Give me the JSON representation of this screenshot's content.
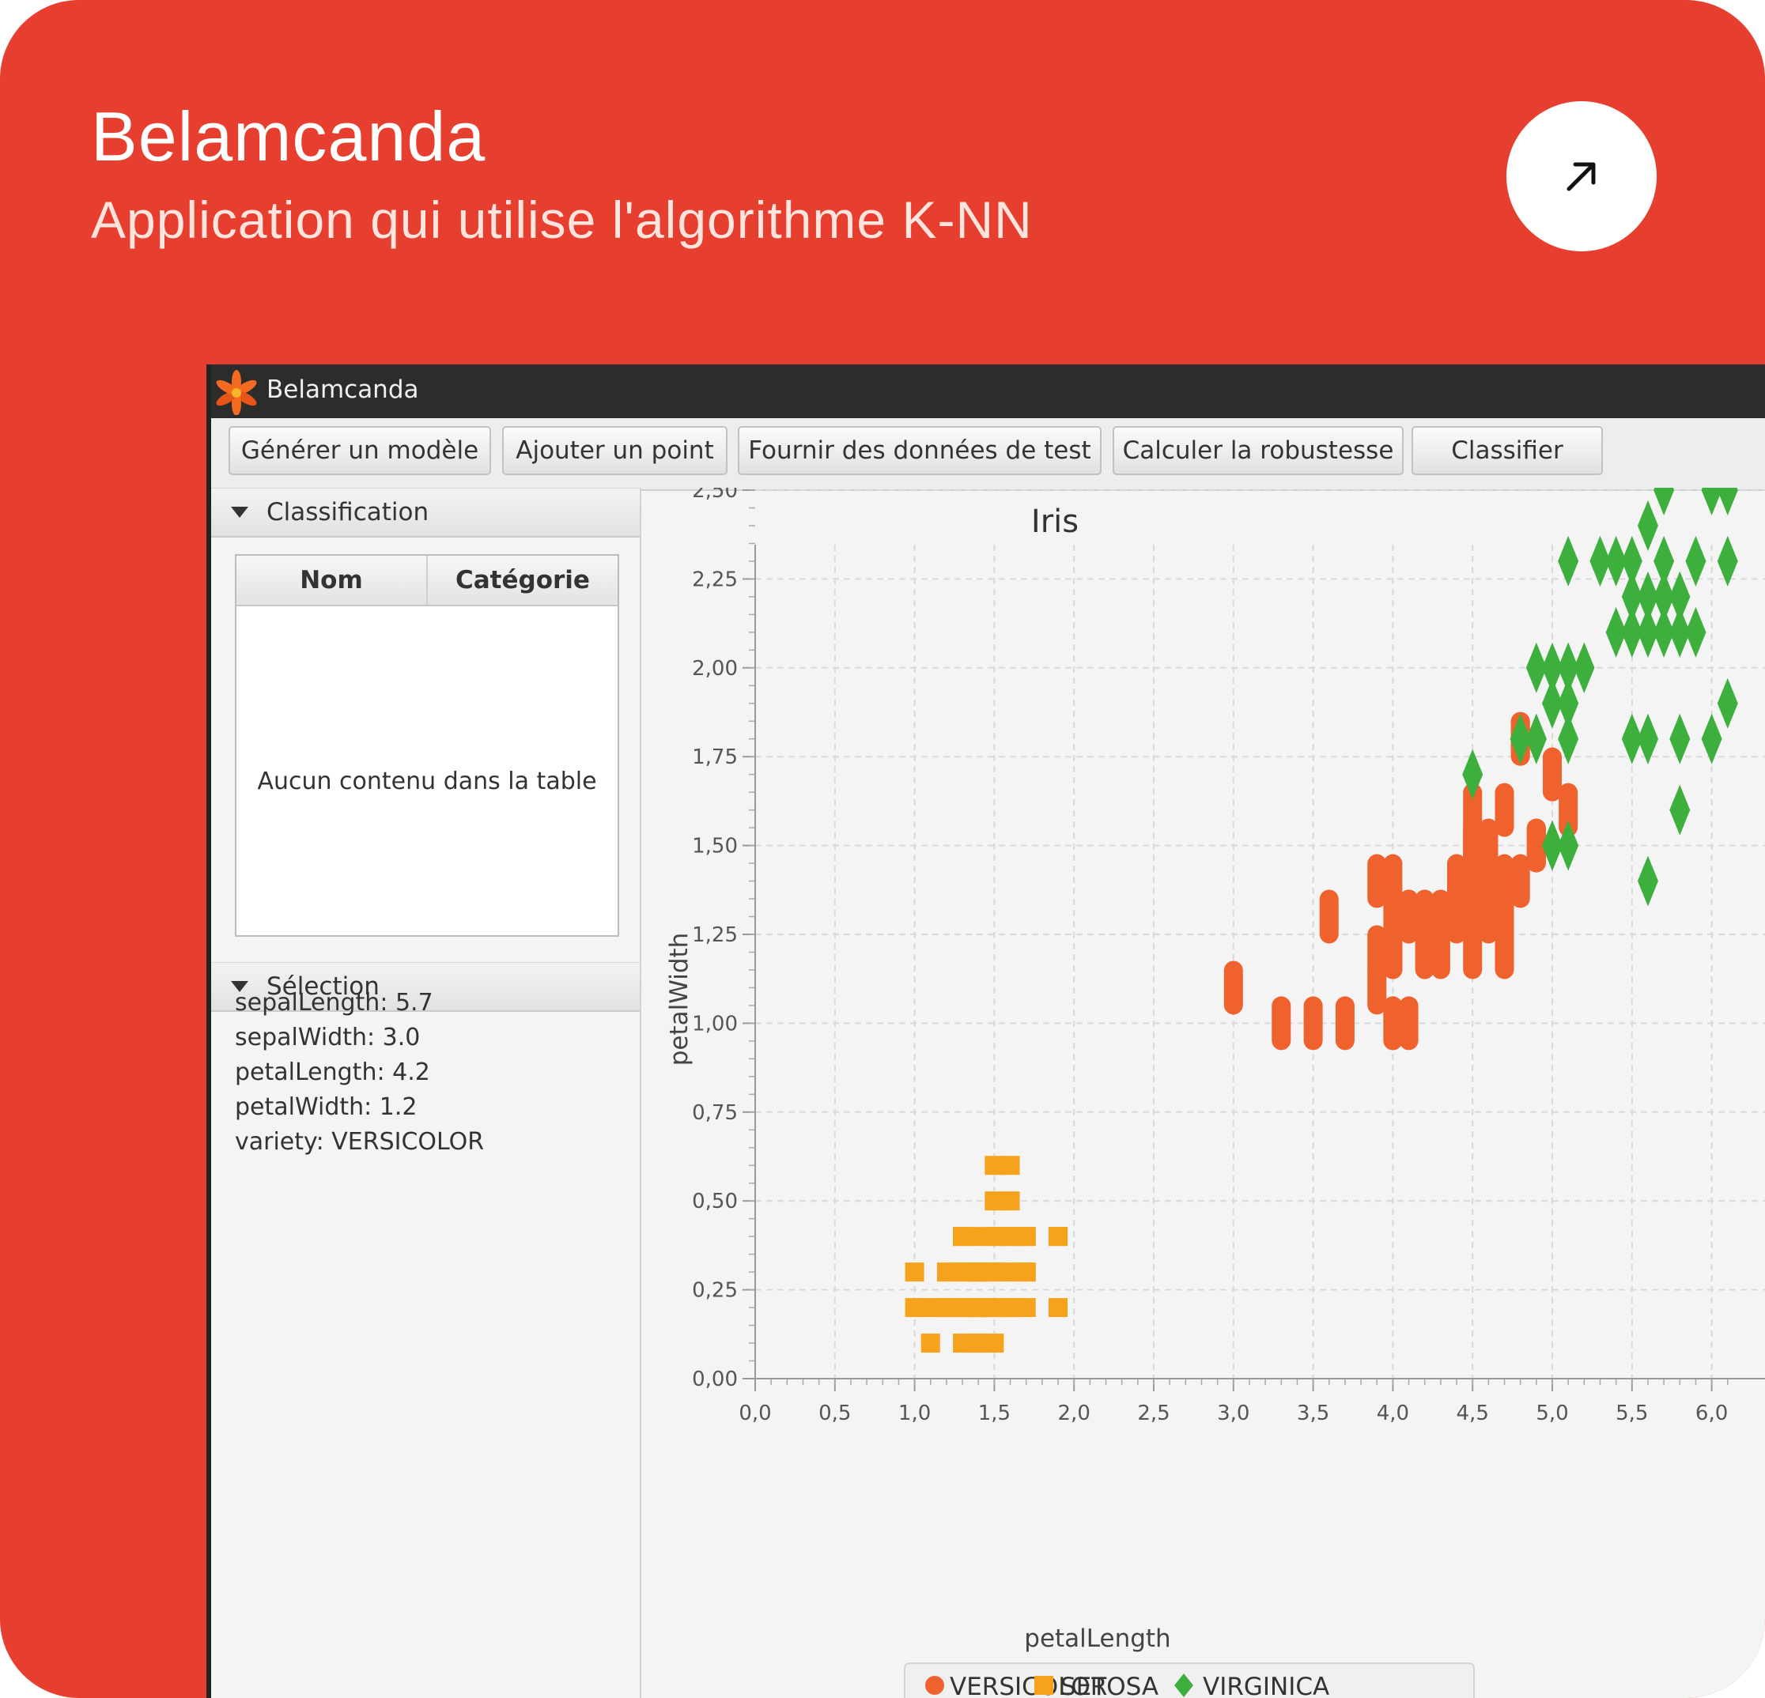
{
  "card": {
    "title": "Belamcanda",
    "subtitle": "Application qui utilise l'algorithme K-NN",
    "background_color": "#e63e2f"
  },
  "open_button": {
    "icon": "arrow-up-right-icon"
  },
  "window": {
    "title": "Belamcanda",
    "app_icon": "lily-flower-icon"
  },
  "toolbar": {
    "buttons": [
      {
        "label": "Générer un modèle"
      },
      {
        "label": "Ajouter un point"
      },
      {
        "label": "Fournir des données de test"
      },
      {
        "label": "Calculer la robustesse"
      },
      {
        "label": "Classifier"
      }
    ]
  },
  "classification_panel": {
    "title": "Classification",
    "columns": [
      "Nom",
      "Catégorie"
    ],
    "empty_message": "Aucun contenu dans la table"
  },
  "selection_panel": {
    "title": "Sélection",
    "properties": [
      "sepalLength: 5.7",
      "sepalWidth: 3.0",
      "petalLength: 4.2",
      "petalWidth: 1.2",
      "variety: VERSICOLOR"
    ]
  },
  "chart_data": {
    "type": "scatter",
    "title": "Iris",
    "xlabel": "petalLength",
    "ylabel": "petalWidth",
    "xlim": [
      0,
      6.1
    ],
    "ylim": [
      0,
      2.75
    ],
    "x_ticks": [
      "0,0",
      "0,5",
      "1,0",
      "1,5",
      "2,0",
      "2,5",
      "3,0",
      "3,5",
      "4,0",
      "4,5",
      "5,0",
      "5,5",
      "6,0"
    ],
    "y_ticks": [
      "0,00",
      "0,25",
      "0,50",
      "0,75",
      "1,00",
      "1,25",
      "1,50",
      "1,75",
      "2,00",
      "2,25",
      "2,50"
    ],
    "grid": true,
    "legend_position": "bottom",
    "series": [
      {
        "name": "VERSICOLOR",
        "marker": "circle",
        "color": "#f0622d",
        "x": [
          3.0,
          3.3,
          3.5,
          3.7,
          3.9,
          4.0,
          4.0,
          3.9,
          4.0,
          4.1,
          4.2,
          4.3,
          4.5,
          4.0,
          4.1,
          4.2,
          4.3,
          4.4,
          4.5,
          4.6,
          4.7,
          4.0,
          4.2,
          4.4,
          4.7,
          4.5,
          4.9,
          5.0,
          4.5,
          4.6,
          4.7,
          4.8,
          4.8,
          5.0,
          4.9,
          5.1,
          3.6,
          4.1,
          4.5,
          4.7,
          4.5,
          4.6,
          4.8,
          4.9,
          3.9,
          4.0,
          4.2,
          4.4,
          4.5,
          4.6
        ],
        "y": [
          1.1,
          1.0,
          1.0,
          1.0,
          1.1,
          1.0,
          1.0,
          1.2,
          1.3,
          1.3,
          1.3,
          1.3,
          1.3,
          1.4,
          1.3,
          1.2,
          1.2,
          1.3,
          1.4,
          1.3,
          1.3,
          1.2,
          1.2,
          1.4,
          1.4,
          1.5,
          1.5,
          1.7,
          1.6,
          1.5,
          1.6,
          1.8,
          1.8,
          1.7,
          1.5,
          1.6,
          1.3,
          1.0,
          1.2,
          1.2,
          1.3,
          1.4,
          1.4,
          1.5,
          1.4,
          1.2,
          1.3,
          1.4,
          1.5,
          1.5
        ]
      },
      {
        "name": "SETOSA",
        "marker": "square",
        "color": "#f7a21c",
        "x": [
          1.0,
          1.1,
          1.2,
          1.3,
          1.4,
          1.5,
          1.6,
          1.7,
          1.9,
          1.2,
          1.3,
          1.4,
          1.5,
          1.6,
          1.7,
          1.4,
          1.5,
          1.6,
          1.7,
          1.3,
          1.5,
          1.9,
          1.5,
          1.6,
          1.6,
          1.3,
          1.4,
          1.5,
          1.6,
          1.7,
          1.0,
          1.1,
          1.2,
          1.3,
          1.4,
          1.5,
          1.6,
          1.7,
          1.9,
          1.3,
          1.4,
          1.4,
          1.5,
          1.6,
          1.4,
          1.5,
          1.4,
          1.3,
          1.5,
          1.4
        ],
        "y": [
          0.2,
          0.1,
          0.2,
          0.2,
          0.2,
          0.2,
          0.2,
          0.2,
          0.2,
          0.3,
          0.3,
          0.3,
          0.3,
          0.3,
          0.3,
          0.4,
          0.4,
          0.4,
          0.4,
          0.4,
          0.5,
          0.4,
          0.6,
          0.6,
          0.5,
          0.2,
          0.1,
          0.1,
          0.2,
          0.4,
          0.3,
          0.2,
          0.2,
          0.3,
          0.2,
          0.2,
          0.2,
          0.3,
          0.4,
          0.1,
          0.1,
          0.2,
          0.4,
          0.4,
          0.3,
          0.3,
          0.2,
          0.4,
          0.2,
          0.3
        ]
      },
      {
        "name": "VIRGINICA",
        "marker": "diamond",
        "color": "#3daf3d",
        "x": [
          4.5,
          4.8,
          4.9,
          5.0,
          5.0,
          5.1,
          5.1,
          5.2,
          5.3,
          5.4,
          5.5,
          5.6,
          5.6,
          5.7,
          5.8,
          5.9,
          6.0,
          6.1,
          5.6,
          5.7,
          5.8,
          6.0,
          4.9,
          5.0,
          5.1,
          5.2,
          5.5,
          5.6,
          5.8,
          6.1,
          5.0,
          5.1,
          5.1,
          5.4,
          5.6,
          5.7,
          5.8,
          5.5,
          5.6,
          5.7,
          4.8,
          5.1,
          4.9,
          5.6,
          5.8,
          6.1,
          5.1,
          5.3,
          5.5,
          5.9
        ],
        "y": [
          1.7,
          1.8,
          1.8,
          1.5,
          1.5,
          1.9,
          2.0,
          2.0,
          2.3,
          2.3,
          2.3,
          2.4,
          2.2,
          2.5,
          2.2,
          2.3,
          2.5,
          2.5,
          2.1,
          2.1,
          2.1,
          1.8,
          2.0,
          2.0,
          2.0,
          2.0,
          1.8,
          1.8,
          1.8,
          1.9,
          1.9,
          1.8,
          1.5,
          2.1,
          2.1,
          2.3,
          1.6,
          2.1,
          1.8,
          2.2,
          1.8,
          1.9,
          1.8,
          1.4,
          2.2,
          2.3,
          2.3,
          2.3,
          2.2,
          2.1
        ]
      }
    ]
  }
}
